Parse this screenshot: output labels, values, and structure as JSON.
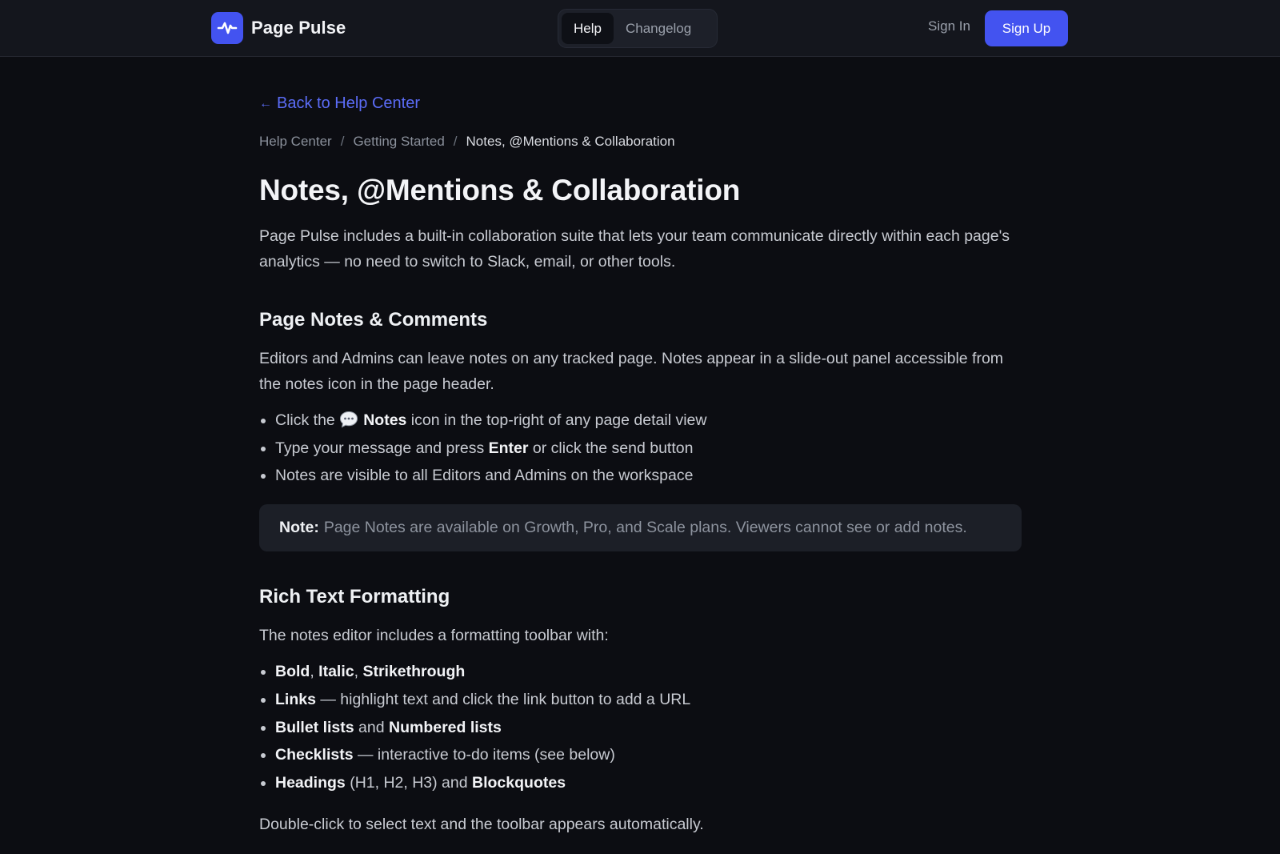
{
  "header": {
    "brand_name": "Page Pulse",
    "nav_tabs": [
      {
        "label": "Help"
      },
      {
        "label": "Changelog"
      }
    ],
    "signin_label": "Sign In",
    "signup_label": "Sign Up"
  },
  "article": {
    "back_link": "Back to Help Center",
    "breadcrumb": {
      "crumb1": "Help Center",
      "crumb2": "Getting Started",
      "current": "Notes, @Mentions & Collaboration",
      "separator": "/"
    },
    "title": "Notes, @Mentions & Collaboration",
    "lead": "Page Pulse includes a built-in collaboration suite that lets your team communicate directly within each page's analytics — no need to switch to Slack, email, or other tools.",
    "section1": {
      "heading": "Page Notes & Comments",
      "para": "Editors and Admins can leave notes on any tracked page. Notes appear in a slide-out panel accessible from the notes icon in the page header.",
      "bullet1": {
        "pre": "Click the ",
        "bold": "Notes",
        "post": " icon in the top-right of any page detail view"
      },
      "bullet2": {
        "pre": "Type your message and press ",
        "bold": "Enter",
        "post": " or click the send button"
      },
      "bullet3": {
        "text": "Notes are visible to all Editors and Admins on the workspace"
      },
      "note_label": "Note:",
      "note_text": "Page Notes are available on Growth, Pro, and Scale plans. Viewers cannot see or add notes."
    },
    "section2": {
      "heading": "Rich Text Formatting",
      "para": "The notes editor includes a formatting toolbar with:",
      "b1": {
        "bold_a": "Bold",
        "sep_a": ", ",
        "bold_b": "Italic",
        "sep_b": ", ",
        "bold_c": "Strikethrough"
      },
      "b2": {
        "bold": "Links",
        "post": " — highlight text and click the link button to add a URL"
      },
      "b3": {
        "bold_a": "Bullet lists",
        "mid": " and ",
        "bold_b": "Numbered lists"
      },
      "b4": {
        "bold": "Checklists",
        "post": " — interactive to-do items (see below)"
      },
      "b5": {
        "bold_a": "Headings",
        "mid": " (H1, H2, H3) and ",
        "bold_b": "Blockquotes"
      },
      "closing": "Double-click to select text and the toolbar appears automatically."
    }
  },
  "colors": {
    "accent": "#4353f0",
    "link": "#5b6cf7",
    "background": "#0c0d12",
    "header_bg": "#14161d"
  },
  "icons": {
    "brand": "pulse-icon",
    "back": "arrow-left-icon",
    "notes": "speech-bubble-icon"
  }
}
